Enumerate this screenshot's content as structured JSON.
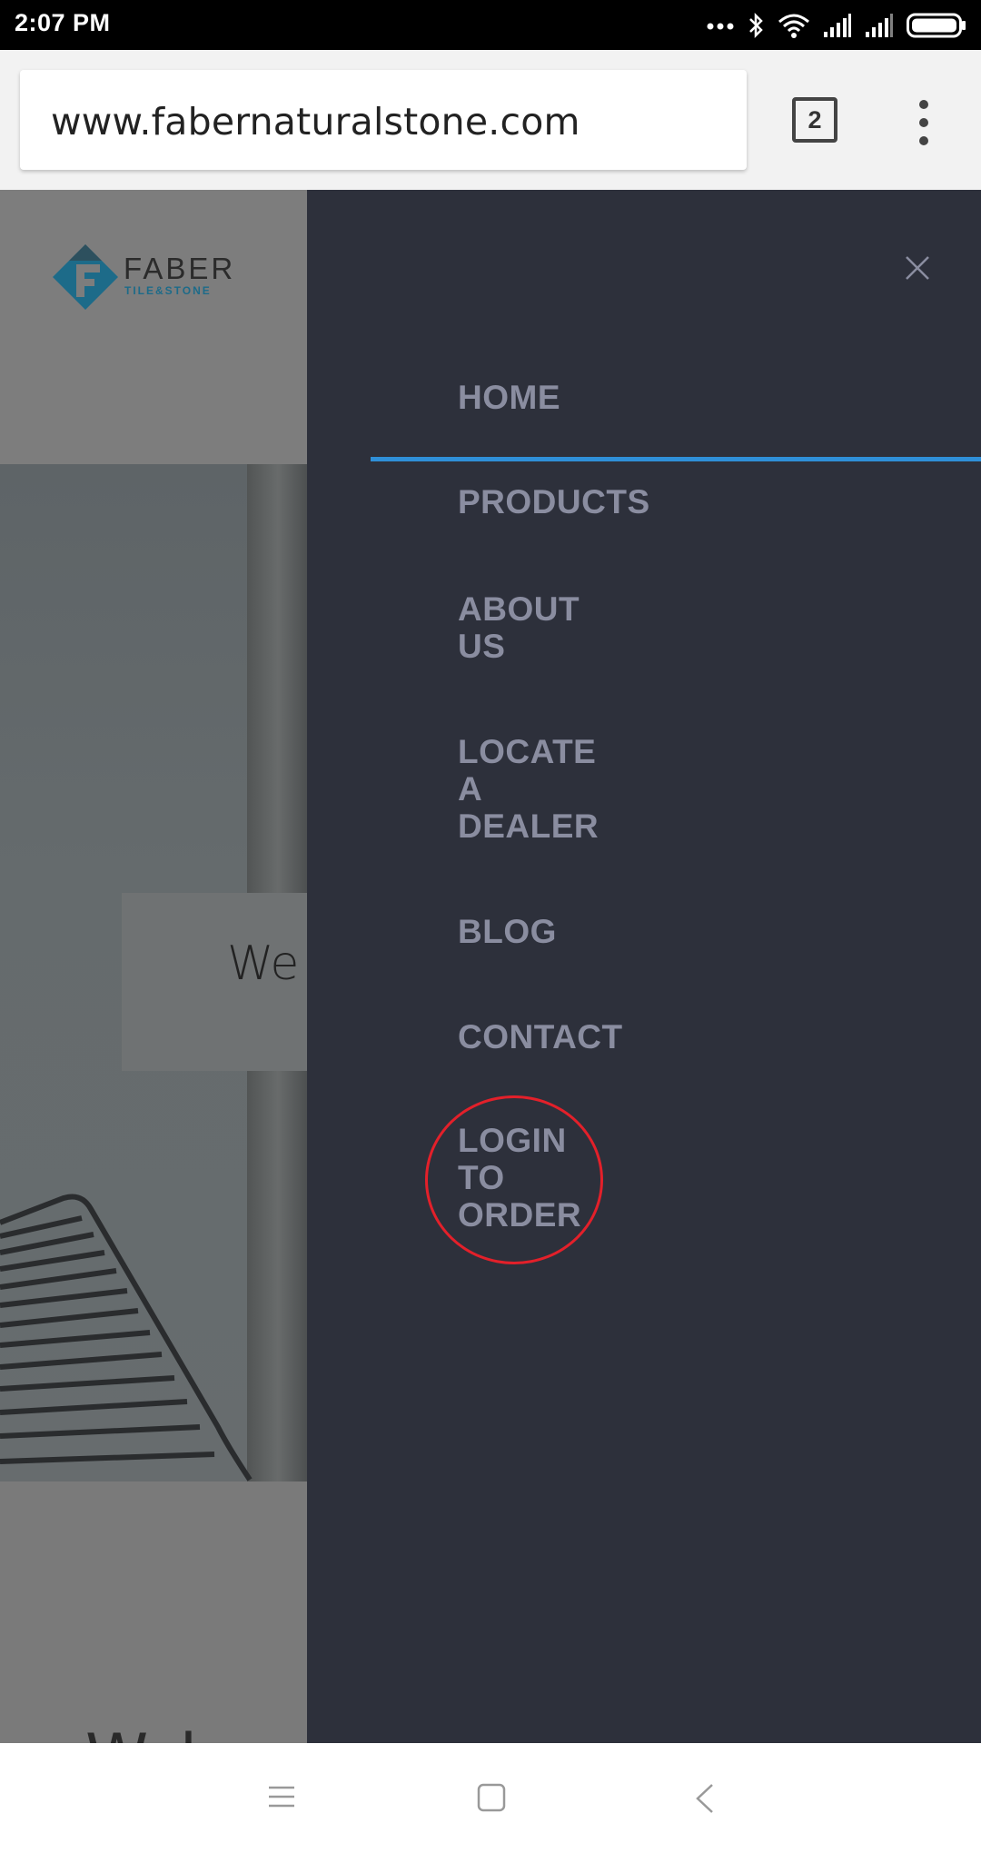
{
  "status_bar": {
    "time": "2:07 PM",
    "icons": [
      "more-dots-icon",
      "bluetooth-icon",
      "wifi-icon",
      "signal-icon",
      "signal-icon",
      "battery-icon"
    ]
  },
  "browser": {
    "url": "www.fabernaturalstone.com",
    "tab_count": "2",
    "menu_icon": "more-vert-icon"
  },
  "site": {
    "logo_text": "FABER",
    "logo_subtext": "TILE&STONE",
    "hero_card_text": "We",
    "bottom_partial_text": "W ł"
  },
  "drawer": {
    "close_icon": "close-icon",
    "active_item": "HOME",
    "items": [
      {
        "lines": [
          "HOME"
        ]
      },
      {
        "lines": [
          "PRODUCTS"
        ]
      },
      {
        "lines": [
          "ABOUT",
          "US"
        ]
      },
      {
        "lines": [
          "LOCATE",
          "A",
          "DEALER"
        ]
      },
      {
        "lines": [
          "BLOG"
        ]
      },
      {
        "lines": [
          "CONTACT"
        ]
      },
      {
        "lines": [
          "LOGIN",
          "TO",
          "ORDER"
        ]
      }
    ],
    "highlight_color": "#e3202a",
    "active_line_color": "#2f8fd8"
  },
  "nav_bar": {
    "icons": [
      "recents-menu-icon",
      "home-square-icon",
      "back-chevron-icon"
    ]
  }
}
